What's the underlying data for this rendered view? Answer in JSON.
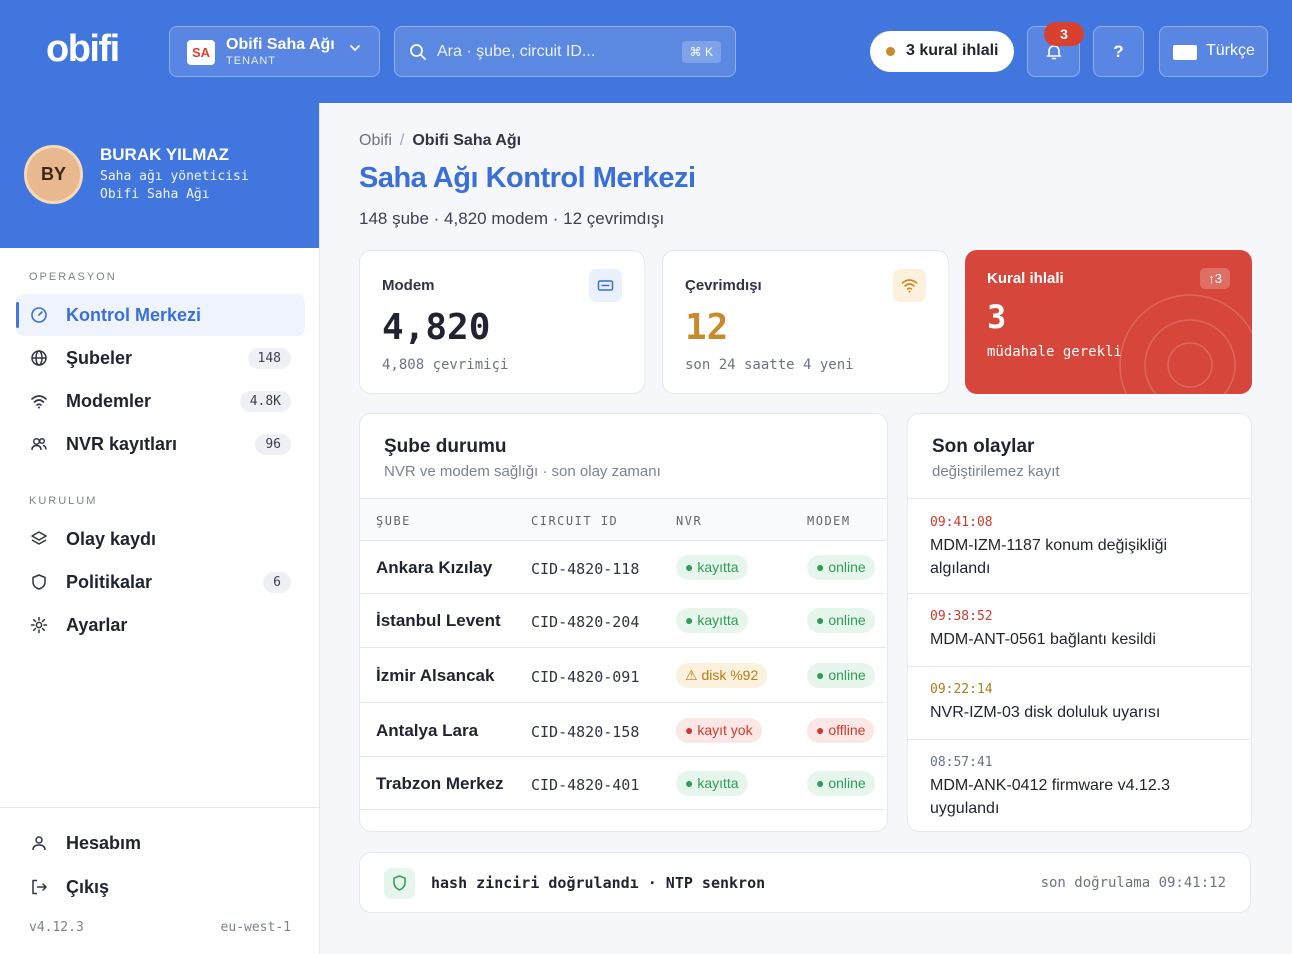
{
  "brand": {
    "logo": "obifi"
  },
  "tenant": {
    "badge": "SA",
    "name": "Obifi Saha Ağı",
    "label": "TENANT"
  },
  "search": {
    "placeholder": "Ara · şube, circuit ID...",
    "shortcut": "⌘ K"
  },
  "header": {
    "violation_label": "3 kural ihlali",
    "notification_count": "3",
    "help_label": "?",
    "language_label": "Türkçe"
  },
  "user": {
    "initials": "BY",
    "name": "BURAK YILMAZ",
    "role": "Saha ağı yöneticisi",
    "org": "Obifi Saha Ağı"
  },
  "sidebar": {
    "section_operations": "OPERASYON",
    "section_setup": "KURULUM",
    "items": [
      {
        "label": "Kontrol Merkezi",
        "count": "",
        "icon": "dashboard-icon",
        "active": true
      },
      {
        "label": "Şubeler",
        "count": "148",
        "icon": "globe-icon"
      },
      {
        "label": "Modemler",
        "count": "4.8K",
        "icon": "wifi-icon"
      },
      {
        "label": "NVR kayıtları",
        "count": "96",
        "icon": "users-icon"
      },
      {
        "label": "Olay kaydı",
        "count": "",
        "icon": "layers-icon"
      },
      {
        "label": "Politikalar",
        "count": "6",
        "icon": "shield-icon"
      },
      {
        "label": "Ayarlar",
        "count": "",
        "icon": "settings-icon"
      }
    ],
    "account_label": "Hesabım",
    "logout_label": "Çıkış",
    "version": "v4.12.3",
    "region": "eu-west-1"
  },
  "breadcrumb": {
    "root": "Obifi",
    "sep": "/",
    "current": "Obifi Saha Ağı"
  },
  "page": {
    "title": "Saha Ağı Kontrol Merkezi",
    "subtitle": "148 şube · 4,820 modem · 12 çevrimdışı"
  },
  "stats": {
    "modem": {
      "label": "Modem",
      "value": "4,820",
      "note": "4,808 çevrimiçi"
    },
    "offline": {
      "label": "Çevrimdışı",
      "value": "12",
      "note": "son 24 saatte 4 yeni"
    },
    "violations": {
      "label": "Kural ihlali",
      "value": "3",
      "note": "müdahale gerekli",
      "tag": "↑3"
    }
  },
  "branch_panel": {
    "title": "Şube durumu",
    "subtitle": "NVR ve modem sağlığı · son olay zamanı",
    "columns": [
      "ŞUBE",
      "CIRCUIT ID",
      "NVR",
      "MODEM"
    ],
    "rows": [
      {
        "name": "Ankara Kızılay",
        "cid": "CID-4820-118",
        "nvr": "● kayıtta",
        "nvr_status": "green",
        "modem": "● online",
        "modem_status": "green"
      },
      {
        "name": "İstanbul Levent",
        "cid": "CID-4820-204",
        "nvr": "● kayıtta",
        "nvr_status": "green",
        "modem": "● online",
        "modem_status": "green"
      },
      {
        "name": "İzmir Alsancak",
        "cid": "CID-4820-091",
        "nvr": "⚠ disk %92",
        "nvr_status": "amber",
        "modem": "● online",
        "modem_status": "green"
      },
      {
        "name": "Antalya Lara",
        "cid": "CID-4820-158",
        "nvr": "● kayıt yok",
        "nvr_status": "red",
        "modem": "● offline",
        "modem_status": "red"
      },
      {
        "name": "Trabzon Merkez",
        "cid": "CID-4820-401",
        "nvr": "● kayıtta",
        "nvr_status": "green",
        "modem": "● online",
        "modem_status": "green"
      }
    ]
  },
  "events_panel": {
    "title": "Son olaylar",
    "subtitle": "değiştirilemez kayıt",
    "events": [
      {
        "time": "09:41:08",
        "text": "MDM-IZM-1187 konum değişikliği algılandı",
        "level": "red"
      },
      {
        "time": "09:38:52",
        "text": "MDM-ANT-0561 bağlantı kesildi",
        "level": "red"
      },
      {
        "time": "09:22:14",
        "text": "NVR-IZM-03 disk doluluk uyarısı",
        "level": "amber"
      },
      {
        "time": "08:57:41",
        "text": "MDM-ANK-0412 firmware v4.12.3 uygulandı",
        "level": "gray"
      }
    ]
  },
  "footer": {
    "hash_status": "hash zinciri doğrulandı · NTP senkron",
    "last_check": "son doğrulama 09:41:12"
  },
  "colors": {
    "primary": "#4176de",
    "danger": "#d6463a",
    "warning": "#c98a2b",
    "success": "#2f9c57"
  }
}
